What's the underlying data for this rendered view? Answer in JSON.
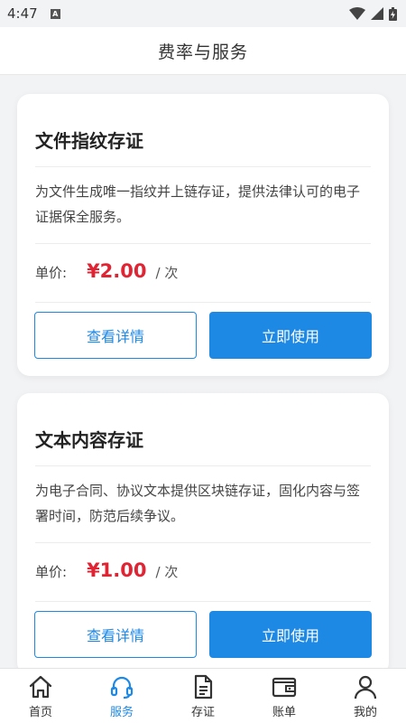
{
  "status_bar": {
    "time": "4:47",
    "notification_glyph": "A"
  },
  "header": {
    "title": "费率与服务"
  },
  "cards": [
    {
      "title": "文件指纹存证",
      "description": "为文件生成唯一指纹并上链存证，提供法律认可的电子证据保全服务。",
      "price_label": "单价:",
      "price": "¥2.00",
      "unit": "/ 次",
      "detail_button": "查看详情",
      "use_button": "立即使用"
    },
    {
      "title": "文本内容存证",
      "description": "为电子合同、协议文本提供区块链存证，固化内容与签署时间，防范后续争议。",
      "price_label": "单价:",
      "price": "¥1.00",
      "unit": "/ 次",
      "detail_button": "查看详情",
      "use_button": "立即使用"
    }
  ],
  "tabbar": {
    "items": [
      {
        "label": "首页",
        "icon": "home-icon"
      },
      {
        "label": "服务",
        "icon": "headset-icon",
        "active": true
      },
      {
        "label": "存证",
        "icon": "document-icon"
      },
      {
        "label": "账单",
        "icon": "wallet-icon"
      },
      {
        "label": "我的",
        "icon": "user-icon"
      }
    ]
  },
  "colors": {
    "accent": "#1e88e5",
    "price": "#e02433",
    "background": "#f2f3f5"
  }
}
